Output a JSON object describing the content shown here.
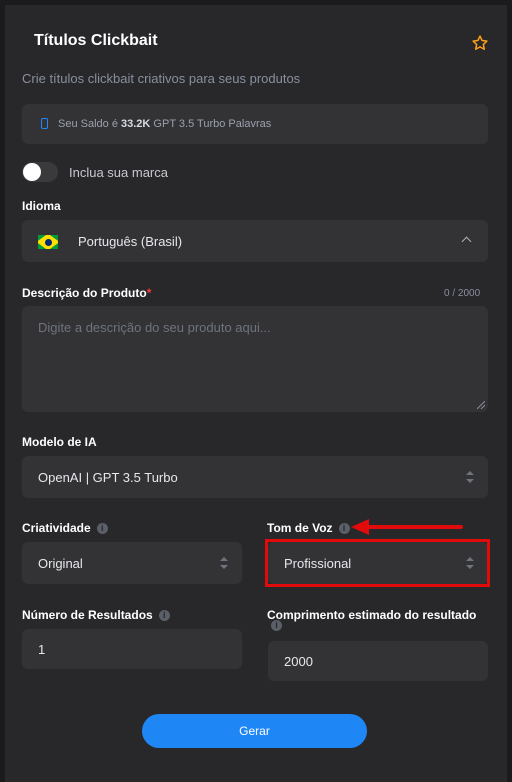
{
  "header": {
    "title": "Títulos Clickbait",
    "subtitle": "Crie títulos clickbait criativos para seus produtos"
  },
  "balance": {
    "prefix": "Seu Saldo é",
    "amount": "33.2K",
    "suffix": "GPT 3.5 Turbo Palavras"
  },
  "brand_toggle": {
    "label": "Inclua sua marca",
    "on": false
  },
  "language": {
    "label": "Idioma",
    "value": "Português (Brasil)"
  },
  "description": {
    "label": "Descrição do Produto",
    "required_mark": "*",
    "counter": "0 / 2000",
    "placeholder": "Digite a descrição do seu produto aqui..."
  },
  "model": {
    "label": "Modelo de IA",
    "value": "OpenAI | GPT 3.5 Turbo"
  },
  "creativity": {
    "label": "Criatividade",
    "value": "Original"
  },
  "tone": {
    "label": "Tom de Voz",
    "value": "Profissional"
  },
  "results": {
    "label": "Número de Resultados",
    "value": "1"
  },
  "length": {
    "label": "Comprimento estimado do resultado",
    "value": "2000"
  },
  "generate_button": {
    "label": "Gerar"
  },
  "colors": {
    "accent": "#1f87f5",
    "annotation": "#e10b0b",
    "star": "#ff9f1a",
    "background": "#28282a",
    "field": "#333335"
  },
  "icons": [
    "star-icon",
    "phone-icon",
    "brazil-flag-icon",
    "chevron-up-icon",
    "info-icon",
    "updown-icon"
  ]
}
